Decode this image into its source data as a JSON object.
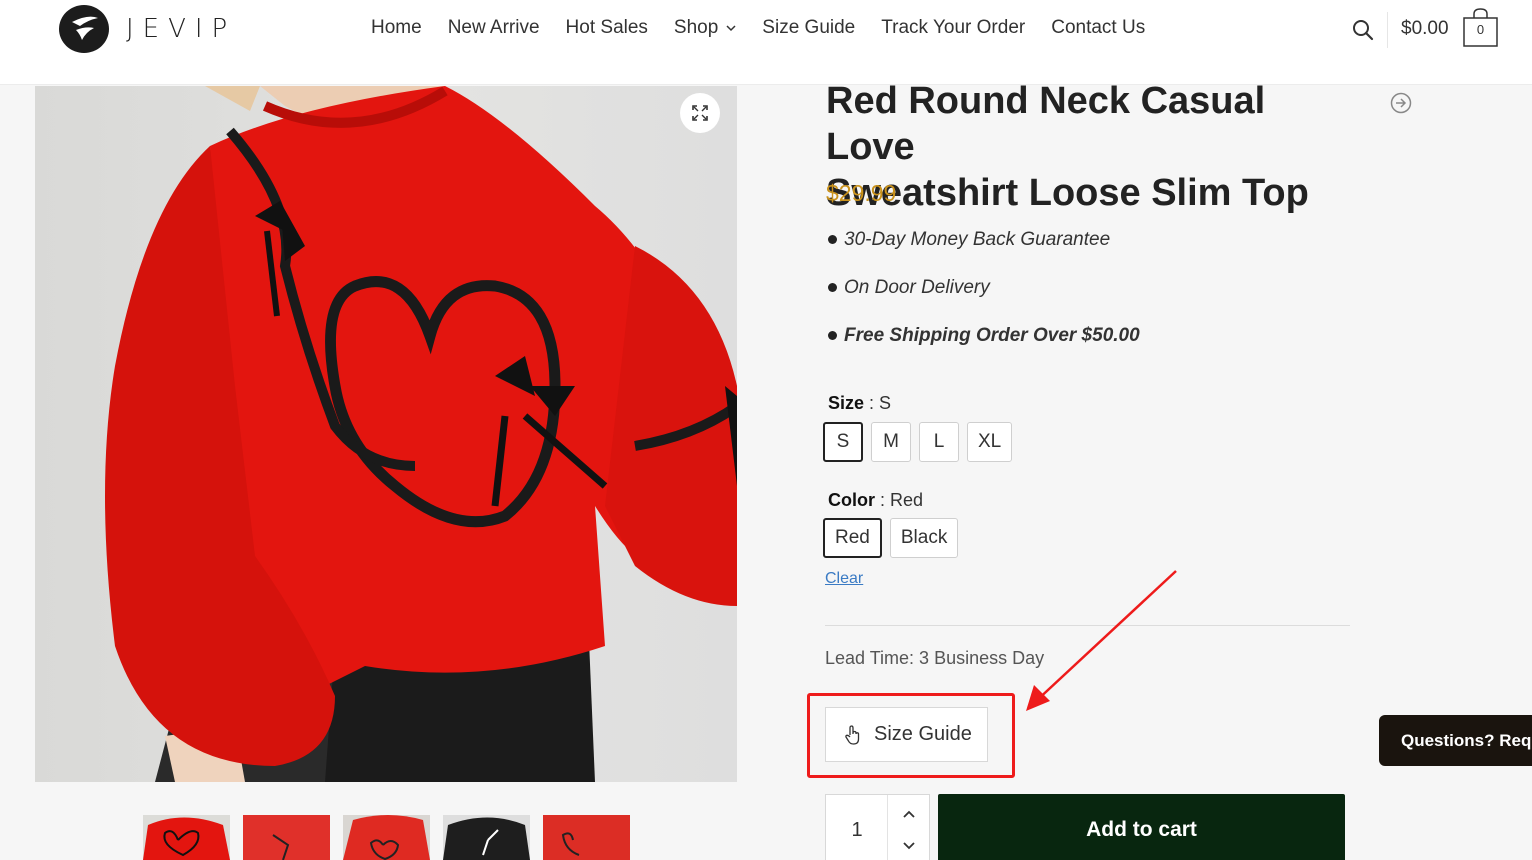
{
  "brand": {
    "name": "JEVIP"
  },
  "nav": {
    "items": [
      {
        "label": "Home"
      },
      {
        "label": "New Arrive"
      },
      {
        "label": "Hot Sales"
      },
      {
        "label": "Shop"
      },
      {
        "label": "Size Guide"
      },
      {
        "label": "Track Your Order"
      },
      {
        "label": "Contact Us"
      }
    ]
  },
  "cart": {
    "total": "$0.00",
    "count": "0"
  },
  "product": {
    "title_line1": "Red Round Neck Casual Love",
    "title_line2": "Sweatshirt Loose Slim Top",
    "price": "$29.99",
    "perks": [
      "30-Day Money Back Guarantee",
      "On Door Delivery",
      "Free Shipping Order Over $50.00"
    ],
    "size": {
      "label": "Size",
      "selected": "S",
      "options": [
        "S",
        "M",
        "L",
        "XL"
      ]
    },
    "color": {
      "label": "Color",
      "selected": "Red",
      "options": [
        "Red",
        "Black"
      ]
    },
    "clear_label": "Clear",
    "lead_time": "Lead Time: 3 Business Day",
    "size_guide_label": "Size Guide",
    "quantity": "1",
    "add_to_cart_label": "Add to cart"
  },
  "chat": {
    "label": "Questions? Requ"
  },
  "colors": {
    "accent_price": "#c9921c",
    "add_to_cart_bg": "#08260f",
    "annotation_red": "#ee1b1b",
    "sweater_red": "#e3150f"
  },
  "icons": [
    "search-icon",
    "shopping-bag-icon",
    "chevron-down-icon",
    "expand-icon",
    "arrow-right-circle-icon",
    "pointer-hand-icon"
  ]
}
